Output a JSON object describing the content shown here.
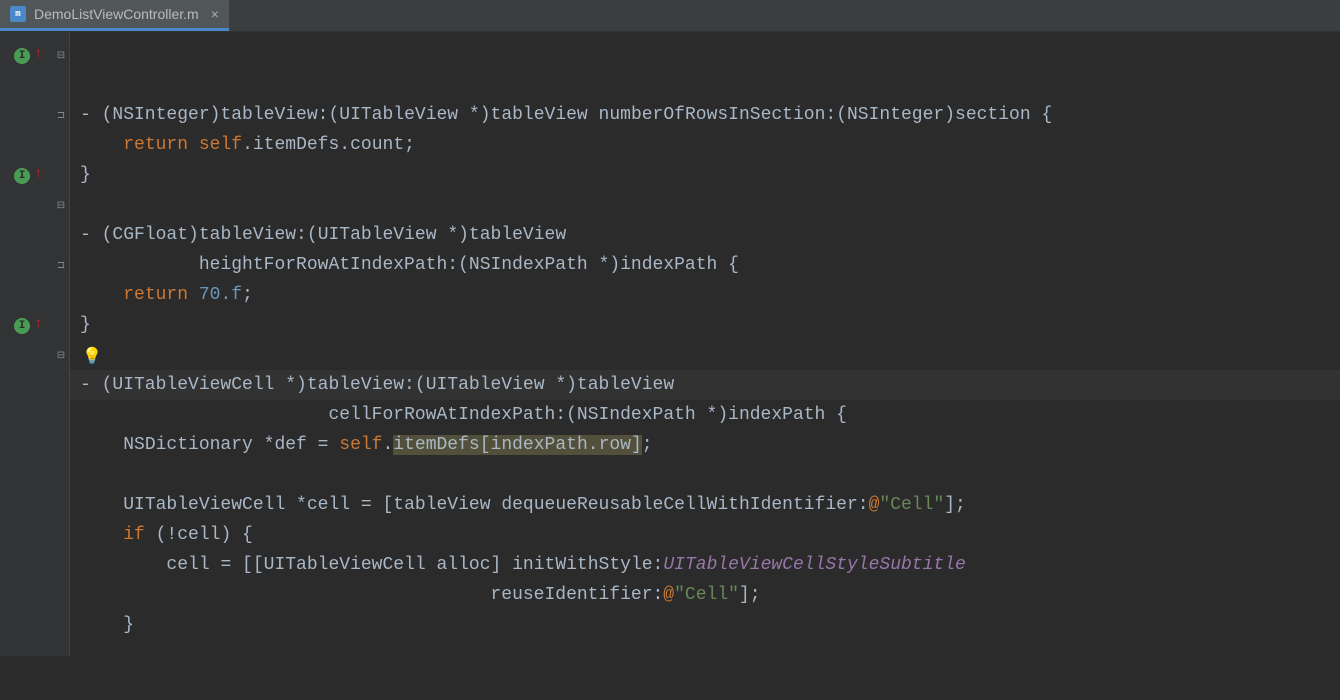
{
  "tab": {
    "filename": "DemoListViewController.m",
    "icon_label": "m"
  },
  "code": {
    "tokens": {
      "ret": "return",
      "self": "self",
      "if": "if",
      "NSInteger": "NSInteger",
      "CGFloat": "CGFloat",
      "UITableView": "UITableView",
      "UITableViewCell": "UITableViewCell",
      "NSIndexPath": "NSIndexPath",
      "NSDictionary": "NSDictionary",
      "tableView": "tableView",
      "tableView_sel": "tableView:",
      "numberOfRowsInSection": "numberOfRowsInSection:",
      "heightForRowAtIndexPath": "heightForRowAtIndexPath:",
      "cellForRowAtIndexPath": "cellForRowAtIndexPath:",
      "dequeueReusable": "dequeueReusableCellWithIdentifier:",
      "initWithStyle": "initWithStyle:",
      "reuseIdentifier": "reuseIdentifier:",
      "section": "section",
      "indexPath": "indexPath",
      "itemDefs": "itemDefs",
      "count": "count",
      "row": "row",
      "def": "def",
      "cell": "cell",
      "alloc": "alloc",
      "subtitleStyle": "UITableViewCellStyleSubtitle",
      "seventy_f": "70.f",
      "cell_str": "\"Cell\"",
      "at": "@"
    }
  }
}
